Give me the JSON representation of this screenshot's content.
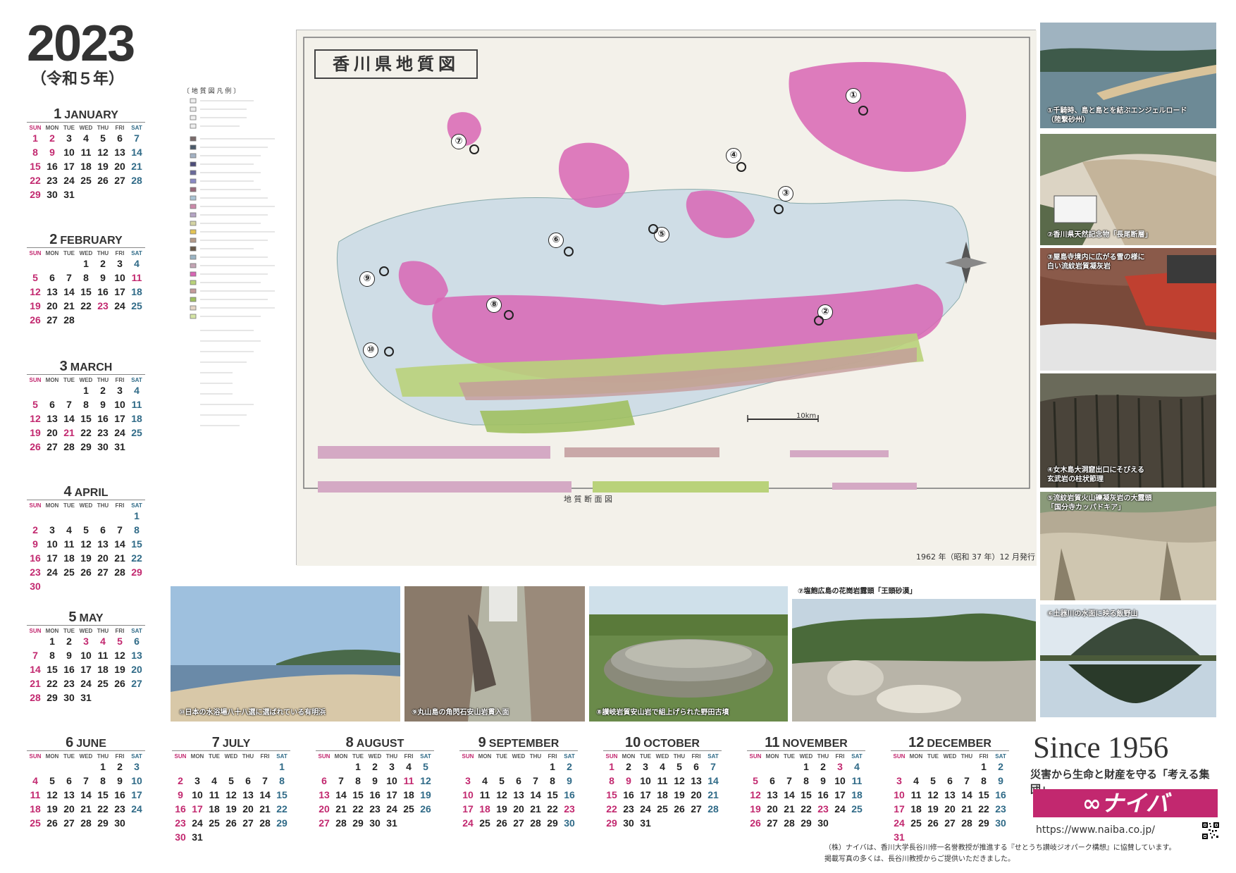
{
  "header": {
    "year": "2023",
    "era": "（令和５年）"
  },
  "weekdays": [
    "SUN",
    "MON",
    "TUE",
    "WED",
    "THU",
    "FRI",
    "SAT"
  ],
  "months": [
    {
      "num": "1",
      "name": "JANUARY",
      "start": 0,
      "days": 31,
      "holidays": [
        1,
        2,
        9
      ]
    },
    {
      "num": "2",
      "name": "FEBRUARY",
      "start": 3,
      "days": 28,
      "holidays": [
        11,
        23
      ]
    },
    {
      "num": "3",
      "name": "MARCH",
      "start": 3,
      "days": 31,
      "holidays": [
        21
      ]
    },
    {
      "num": "4",
      "name": "APRIL",
      "start": 6,
      "days": 30,
      "holidays": [
        29
      ]
    },
    {
      "num": "5",
      "name": "MAY",
      "start": 1,
      "days": 31,
      "holidays": [
        3,
        4,
        5
      ]
    },
    {
      "num": "6",
      "name": "JUNE",
      "start": 4,
      "days": 30,
      "holidays": []
    },
    {
      "num": "7",
      "name": "JULY",
      "start": 6,
      "days": 31,
      "holidays": [
        17
      ]
    },
    {
      "num": "8",
      "name": "AUGUST",
      "start": 2,
      "days": 31,
      "holidays": [
        11
      ]
    },
    {
      "num": "9",
      "name": "SEPTEMBER",
      "start": 5,
      "days": 30,
      "holidays": [
        18,
        23
      ]
    },
    {
      "num": "10",
      "name": "OCTOBER",
      "start": 0,
      "days": 31,
      "holidays": [
        9
      ]
    },
    {
      "num": "11",
      "name": "NOVEMBER",
      "start": 3,
      "days": 30,
      "holidays": [
        3,
        23
      ]
    },
    {
      "num": "12",
      "name": "DECEMBER",
      "start": 5,
      "days": 31,
      "holidays": []
    }
  ],
  "map": {
    "title": "香川県地質図",
    "legend_title": "〔 地 質 図 凡 例 〕",
    "section_title": "地 質 断 面 図",
    "scale": "10km",
    "issued": "1962 年（昭和 37 年）12 月発行",
    "markers": [
      "①",
      "②",
      "③",
      "④",
      "⑤",
      "⑥",
      "⑦",
      "⑧",
      "⑨",
      "⑩"
    ]
  },
  "photos": {
    "p1": "①千騎時、島と島とを結ぶエンジェルロード\n（陸繋砂州）",
    "p2": "②香川県天然記念物「長尾断層」",
    "p3": "③屋島寺境内に広がる雪の様に\n白い流紋岩質凝灰岩",
    "p4": "④女木島大洞窟出口にそびえる\n玄武岩の柱状節理",
    "p5": "⑤流紋岩質火山礫凝灰岩の大露頭\n「国分寺カッパドキア」",
    "p6": "⑥土器川の水面に映る飯野山",
    "p7": "⑦塩飽広島の花崗岩露頭「王頭砂漠」",
    "p8": "⑧讃岐岩質安山岩で組上げられた野田古墳",
    "p9": "⑨丸山島の角閃石安山岩貫入面",
    "p10": "⑩日本の水浴場八十八選に選ばれている有明浜"
  },
  "company": {
    "since": "Since 1956",
    "slogan": "災害から生命と財産を守る「考える集団」",
    "logo": "∞ナイバ",
    "url": "https://www.naiba.co.jp/",
    "foot1": "（株）ナイバは、香川大学長谷川修一名誉教授が推進する『せとうち讃岐ジオパーク構想』に協賛しています。",
    "foot2": "掲載写真の多くは、長谷川教授からご提供いただきました。"
  },
  "colors": {
    "sun": "#c2286f",
    "sat": "#2f6a87",
    "brand": "#c2286f"
  }
}
